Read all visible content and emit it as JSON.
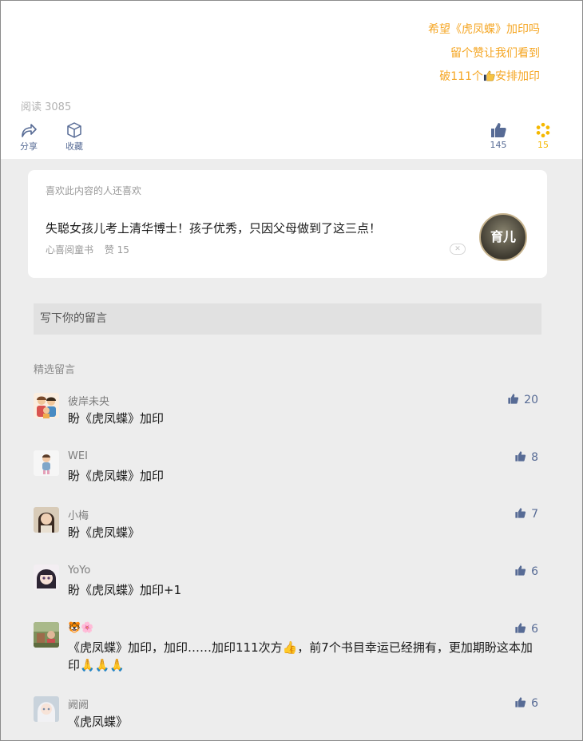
{
  "promo": {
    "line1": "希望《虎凤蝶》加印吗",
    "line2": "留个赞让我们看到",
    "line3_a": "破111个",
    "line3_b": "安排加印",
    "color": "#f5a623"
  },
  "article": {
    "read_label": "阅读 3085",
    "share_label": "分享",
    "fav_label": "收藏",
    "like_count": "145",
    "wow_count": "15",
    "accent": "#576b95",
    "wow_color": "#f5b800"
  },
  "recommend": {
    "header": "喜欢此内容的人还喜欢",
    "title": "失聪女孩儿考上清华博士！孩子优秀，只因父母做到了这三点！",
    "source": "心喜阅童书",
    "likes": "赞 15",
    "close_icon": "close-icon",
    "thumb_text": "育儿"
  },
  "comment_input": {
    "placeholder": "写下你的留言"
  },
  "comments_header": "精选留言",
  "comments": [
    {
      "name": "彼岸未央",
      "text": "盼《虎凤蝶》加印",
      "likes": "20",
      "avatar": "family-avatar"
    },
    {
      "name": "WEI",
      "text": "盼《虎凤蝶》加印",
      "likes": "8",
      "avatar": "child-avatar"
    },
    {
      "name": "小梅",
      "text": "盼《虎凤蝶》",
      "likes": "7",
      "avatar": "woman-avatar"
    },
    {
      "name": "YoYo",
      "text": "盼《虎凤蝶》加印+1",
      "likes": "6",
      "avatar": "anime-girl-avatar"
    },
    {
      "name": "🐯🌸",
      "text": "《虎凤蝶》加印，加印……加印111次方👍，前7个书目幸运已经拥有，更加期盼这本加印🙏🙏🙏",
      "likes": "6",
      "avatar": "outdoor-avatar"
    },
    {
      "name": "阙阙",
      "text": "《虎凤蝶》",
      "likes": "6",
      "avatar": "cartoon-girl-avatar"
    }
  ]
}
